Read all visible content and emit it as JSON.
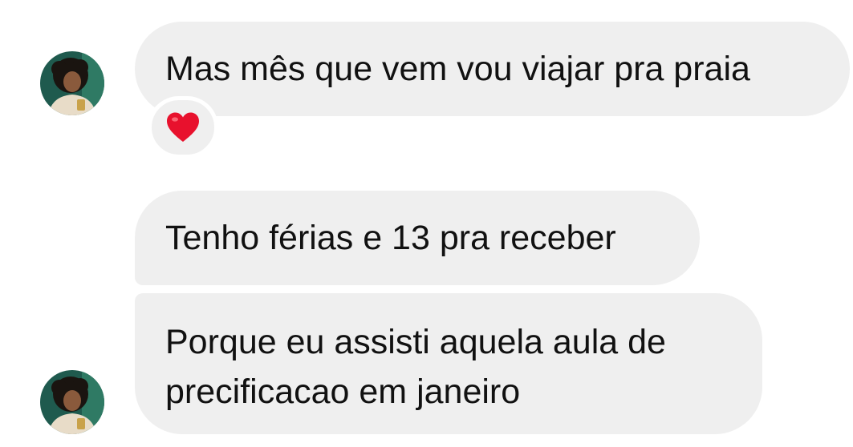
{
  "conversation": {
    "messages": [
      {
        "text": "Mas mês que vem vou viajar pra praia",
        "reaction": "❤️"
      },
      {
        "text": "Tenho férias e 13 pra receber"
      },
      {
        "lines": [
          "Porque eu assisti aquela aula de",
          "precificacao em janeiro"
        ]
      }
    ]
  },
  "colors": {
    "bubble": "#efefef",
    "text": "#111111",
    "heart": "#e8112d",
    "background": "#ffffff"
  }
}
